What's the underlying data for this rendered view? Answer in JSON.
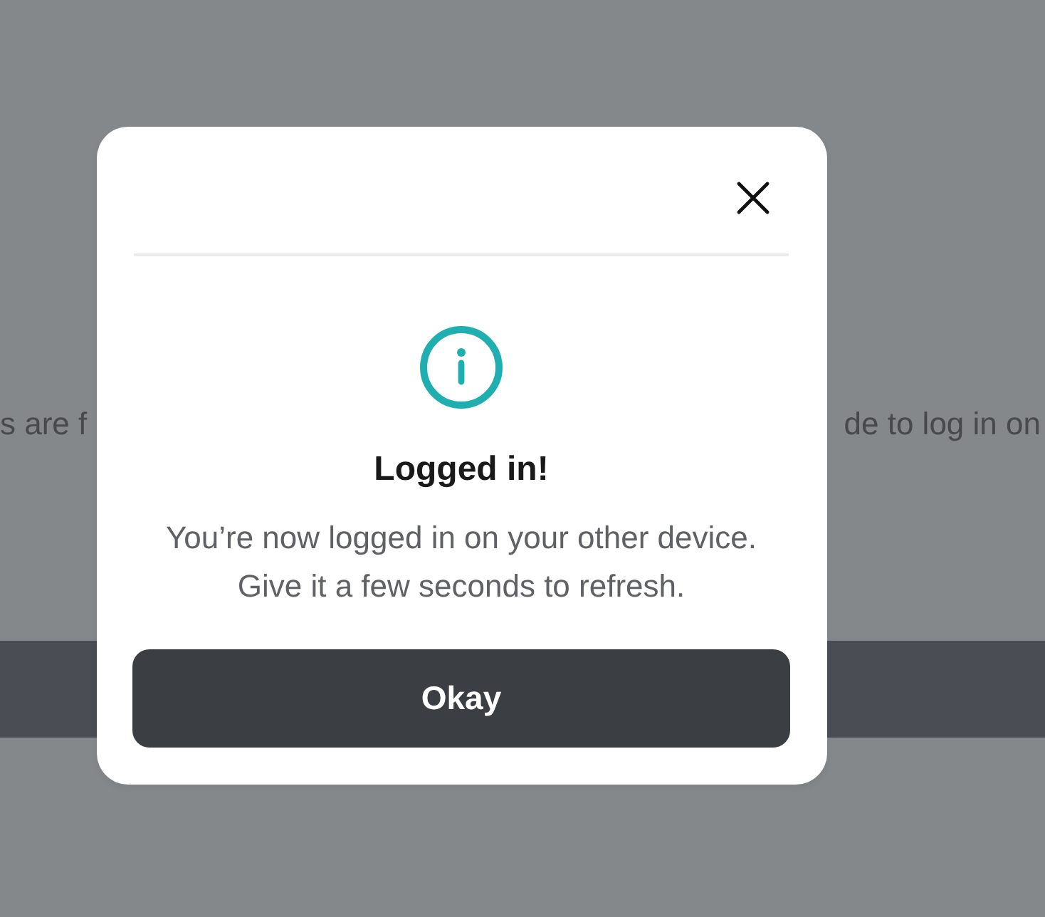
{
  "background": {
    "text_left": "s are f",
    "text_right": "de to log in on"
  },
  "dialog": {
    "title": "Logged in!",
    "message": "You’re now logged in on your other device.\nGive it a few seconds to refresh.",
    "button": "Okay"
  }
}
